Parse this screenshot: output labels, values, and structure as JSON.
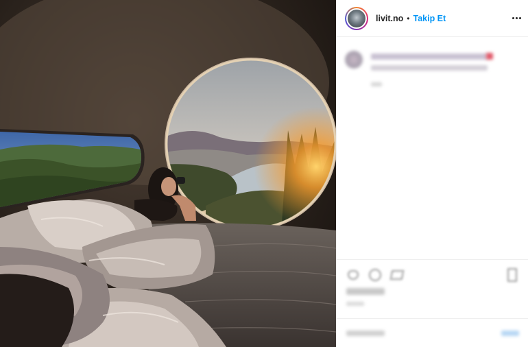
{
  "post": {
    "author": {
      "username": "livit.no",
      "separator": "•",
      "follow_label": "Takip Et"
    }
  },
  "colors": {
    "link": "#0095f6",
    "text": "#262626",
    "divider": "#efefef"
  },
  "icons": {
    "more": "more-options-icon",
    "like": "heart-icon",
    "comment": "comment-icon",
    "share": "share-icon",
    "save": "bookmark-icon"
  }
}
